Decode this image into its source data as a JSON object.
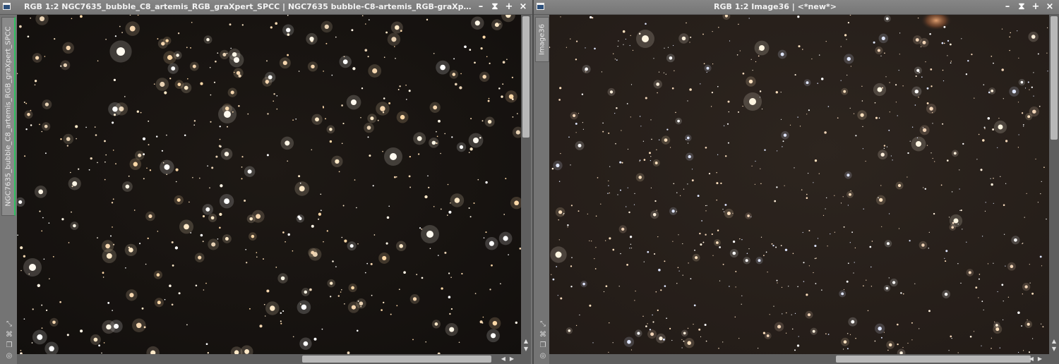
{
  "left_window": {
    "title": "RGB 1:2 NGC7635_bubble_C8_artemis_RGB_graXpert_SPCC | NGC7635 bubble-C8-artemis_RGB-graXpe...",
    "side_tab": "NGC7635_bubble_C8_artemis_RGB_graXpert_SPCC",
    "buttons": {
      "minimize": "–",
      "shade": "⧗",
      "maximize": "+",
      "close": "×"
    }
  },
  "right_window": {
    "title": "RGB 1:2 Image36 | <*new*>",
    "side_tab": "Image36",
    "buttons": {
      "minimize": "–",
      "shade": "⧗",
      "maximize": "+",
      "close": "×"
    }
  },
  "icons": {
    "window": "window-icon",
    "pin": "pin-icon",
    "link": "link-icon",
    "copy": "copy-icon",
    "target": "target-icon"
  },
  "colors": {
    "titlebar": "#7a7a7a",
    "left_active_edge": "#2fbf5f",
    "left_sky": "#161210",
    "right_sky": "#2a221c"
  }
}
